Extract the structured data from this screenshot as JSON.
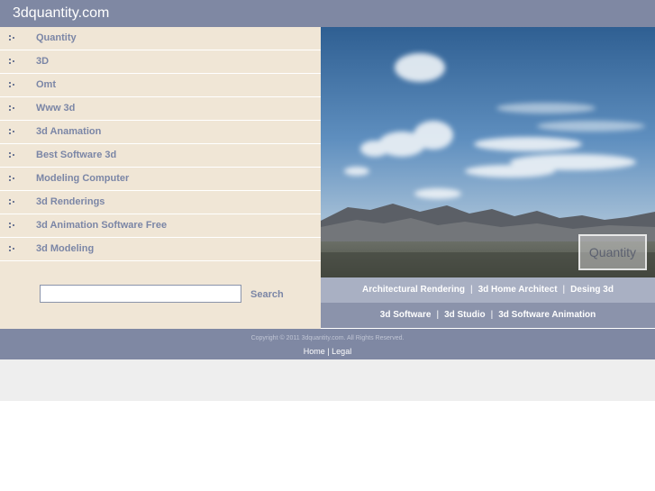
{
  "site": {
    "title": "3dquantity.com"
  },
  "sidebar": {
    "items": [
      {
        "label": "Quantity"
      },
      {
        "label": "3D"
      },
      {
        "label": "Omt"
      },
      {
        "label": "Www 3d"
      },
      {
        "label": "3d Anamation"
      },
      {
        "label": "Best Software 3d"
      },
      {
        "label": "Modeling Computer"
      },
      {
        "label": "3d Renderings"
      },
      {
        "label": "3d Animation Software Free"
      },
      {
        "label": "3d Modeling"
      }
    ]
  },
  "search": {
    "value": "",
    "button_label": "Search"
  },
  "hero": {
    "badge_label": "Quantity",
    "image": "sky-clouds-mountains-desert-landscape"
  },
  "links": {
    "row1": [
      "Architectural Rendering",
      "3d Home Architect",
      "Desing 3d"
    ],
    "row2": [
      "3d Software",
      "3d Studio",
      "3d Software Animation"
    ],
    "separator": "|"
  },
  "footer": {
    "copyright": "Copyright © 2011 3dquantity.com. All Rights Reserved.",
    "home": "Home",
    "separator": "|",
    "legal": "Legal"
  },
  "colors": {
    "header_bg": "#7f88a3",
    "sidebar_bg": "#f0e6d6",
    "link_text": "#7b86a6",
    "links_row1_bg": "#a9b0c3",
    "links_row2_bg": "#8b93ab"
  }
}
